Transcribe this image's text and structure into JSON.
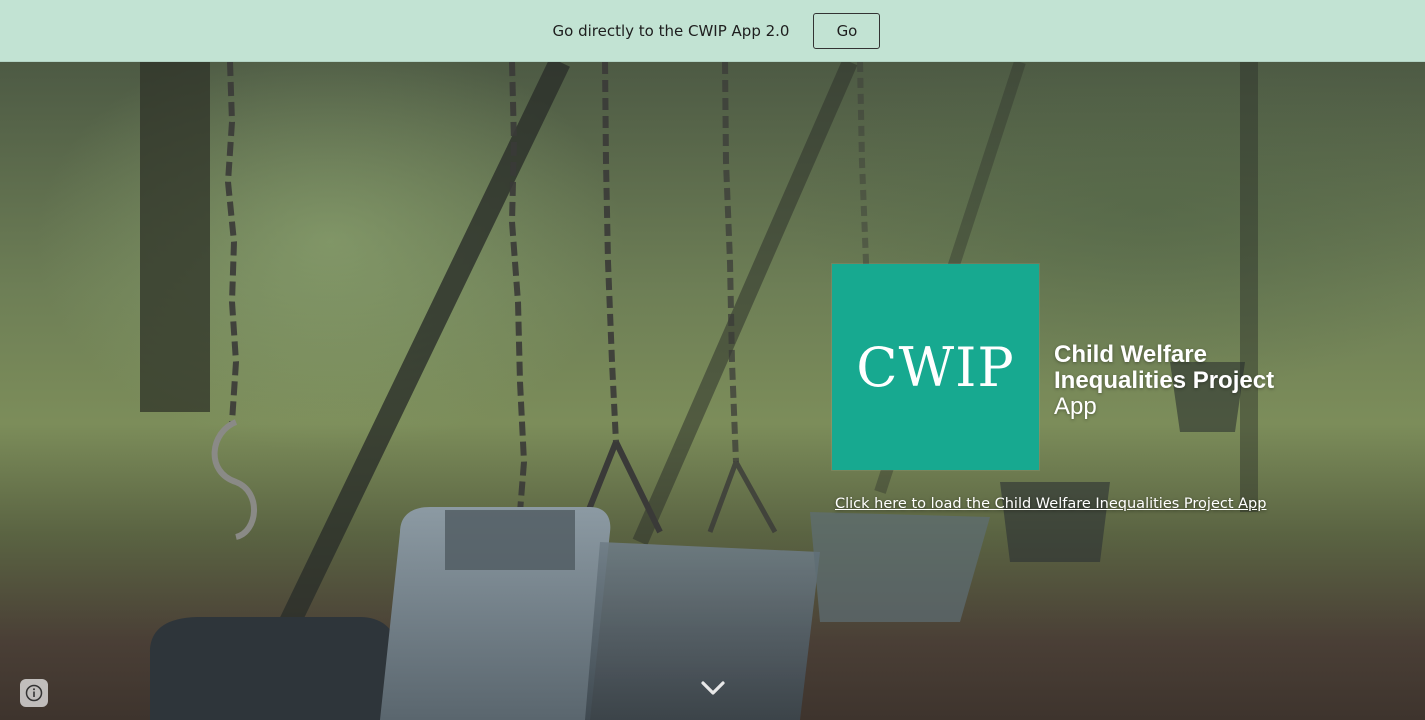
{
  "banner": {
    "text": "Go directly to the CWIP App 2.0",
    "go_label": "Go",
    "background": "#c2e3d3"
  },
  "hero": {
    "logo": {
      "text": "CWIP",
      "color": "#17a990"
    },
    "title_line1": "Child Welfare",
    "title_line2": "Inequalities Project",
    "title_line3": "App",
    "load_link": "Click here to load the Child Welfare Inequalities Project App",
    "background_image": "playground swings with chains, blurred park background"
  },
  "icons": {
    "scroll": "chevron-down-icon",
    "info": "info-icon"
  }
}
